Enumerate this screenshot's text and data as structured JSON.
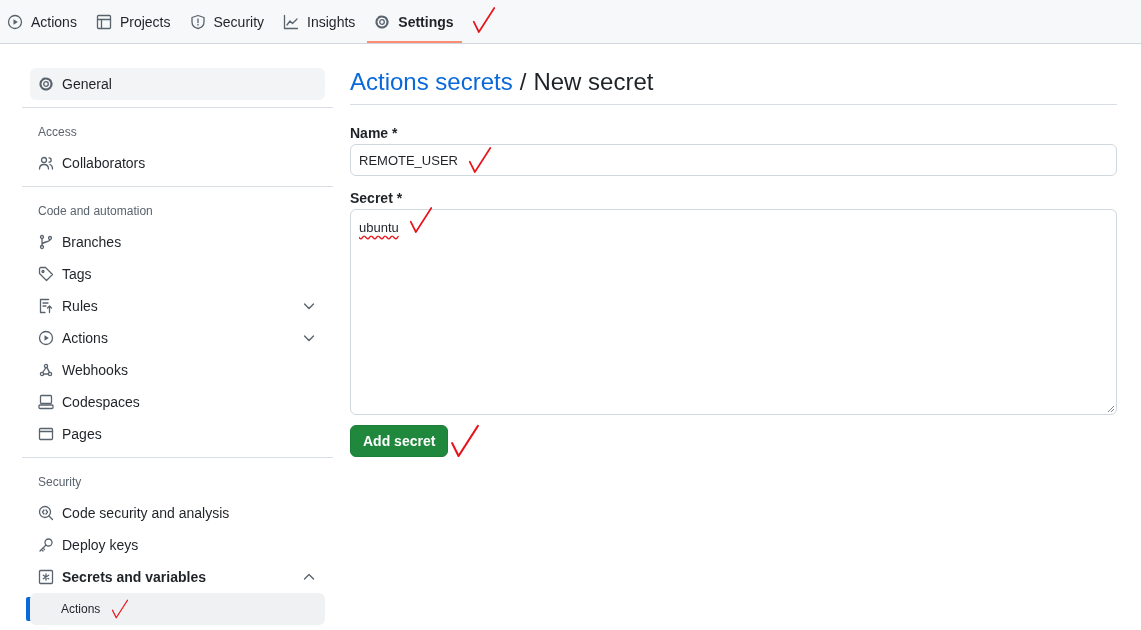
{
  "nav_tabs": [
    {
      "label": "Actions",
      "selected": false
    },
    {
      "label": "Projects",
      "selected": false
    },
    {
      "label": "Security",
      "selected": false
    },
    {
      "label": "Insights",
      "selected": false
    },
    {
      "label": "Settings",
      "selected": true
    }
  ],
  "sidebar": {
    "groups": [
      {
        "items": [
          {
            "label": "General",
            "selected": false,
            "hovered": true
          }
        ]
      },
      {
        "heading": "Access",
        "items": [
          {
            "label": "Collaborators",
            "selected": false
          }
        ]
      },
      {
        "heading": "Code and automation",
        "items": [
          {
            "label": "Branches",
            "selected": false
          },
          {
            "label": "Tags",
            "selected": false
          },
          {
            "label": "Rules",
            "selected": false,
            "expanded": false
          },
          {
            "label": "Actions",
            "selected": false,
            "expanded": false
          },
          {
            "label": "Webhooks",
            "selected": false
          },
          {
            "label": "Codespaces",
            "selected": false
          },
          {
            "label": "Pages",
            "selected": false
          }
        ]
      },
      {
        "heading": "Security",
        "items": [
          {
            "label": "Code security and analysis",
            "selected": false
          },
          {
            "label": "Deploy keys",
            "selected": false
          },
          {
            "label": "Secrets and variables",
            "selected": false,
            "expanded": true,
            "children": [
              {
                "label": "Actions",
                "selected": true
              }
            ]
          }
        ]
      }
    ]
  },
  "breadcrumb": {
    "link": "Actions secrets",
    "separator": "/",
    "current": "New secret"
  },
  "form": {
    "fields": [
      {
        "kind": "input",
        "label": "Name *",
        "value": "REMOTE_USER"
      },
      {
        "kind": "textarea",
        "label": "Secret *",
        "value": "ubuntu",
        "spellcheck_error": true
      }
    ],
    "submit": "Add secret"
  }
}
